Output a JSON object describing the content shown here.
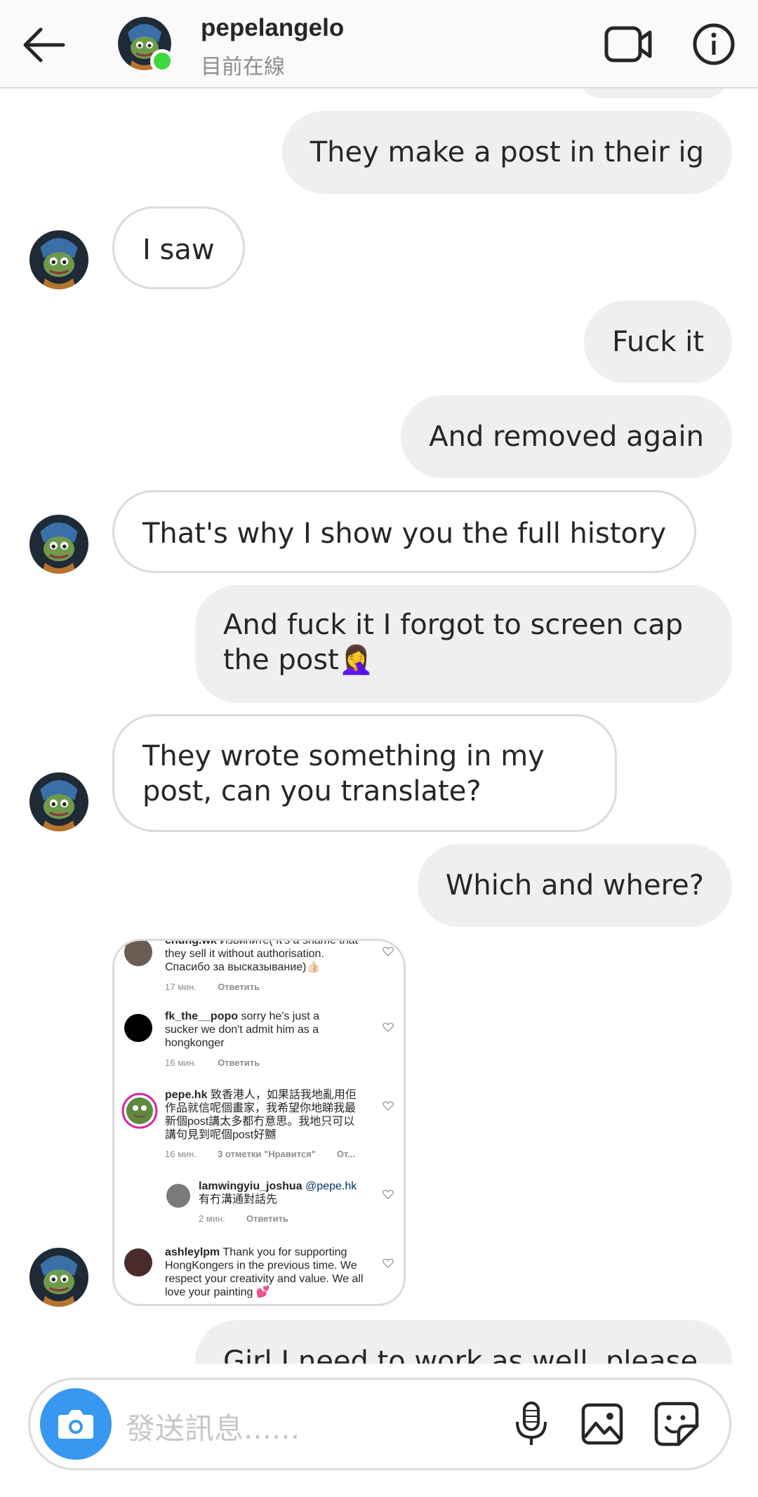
{
  "header": {
    "username": "pepelangelo",
    "status": "目前在線",
    "back_icon": "arrow-left-icon",
    "video_icon": "video-camera-icon",
    "info_icon": "info-icon"
  },
  "messages": [
    {
      "side": "out",
      "text": "They make a post in their ig"
    },
    {
      "side": "in",
      "text": "I saw"
    },
    {
      "side": "out",
      "text": "Fuck it"
    },
    {
      "side": "out",
      "text": "And removed again"
    },
    {
      "side": "in",
      "text": "That's why I show you the full history"
    },
    {
      "side": "out",
      "text": "And fuck it I forgot to screen cap the post🤦‍♀️"
    },
    {
      "side": "in",
      "text": "They wrote something in my post, can you translate?"
    },
    {
      "side": "out",
      "text": "Which and where?"
    },
    {
      "side": "out",
      "text": "Girl I need to work as well, please"
    }
  ],
  "shared_screenshot": {
    "comments": [
      {
        "user": "chung.wk",
        "text": "Извините( It's a shame that they sell it  without authorisation. Спасибо за высказывание)👍🏻",
        "time": "17 мин.",
        "reply": "Ответить"
      },
      {
        "user": "fk_the__popo",
        "text": "sorry he's just a sucker we don't admit him as a hongkonger",
        "time": "16 мин.",
        "reply": "Ответить"
      },
      {
        "user": "pepe.hk",
        "text": "致香港人，如果話我地亂用佢作品就信呢個畫家，我希望你地睇我最新個post講太多都冇意思。我地只可以講句見到呢個post好嬲",
        "time": "16 мин.",
        "likes": "3 отметки \"Нравится\"",
        "reply": "От..."
      },
      {
        "user": "lamwingyiu_joshua",
        "mention": "@pepe.hk",
        "text": "有冇溝通對話先",
        "time": "2 мин.",
        "reply": "Ответить"
      },
      {
        "user": "ashleylpm",
        "text": "Thank you for supporting HongKongers in the previous time. We respect your creativity and value. We all love your painting 💕"
      }
    ]
  },
  "composer": {
    "placeholder": "發送訊息......",
    "camera_icon": "camera-icon",
    "mic_icon": "microphone-icon",
    "gallery_icon": "image-icon",
    "sticker_icon": "sticker-icon"
  },
  "colors": {
    "accent": "#3897f0",
    "online": "#3dd83d",
    "outgoing_bubble": "#efefef",
    "border": "#dbdbdb"
  }
}
